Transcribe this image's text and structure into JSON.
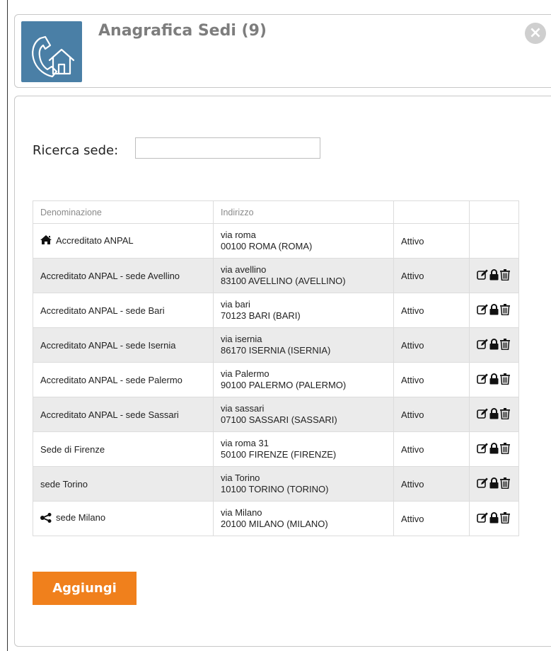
{
  "dialog": {
    "title": "Anagrafica Sedi (9)",
    "close_label": "×"
  },
  "search": {
    "label": "Ricerca sede:",
    "value": "",
    "placeholder": ""
  },
  "table": {
    "headers": [
      "Denominazione",
      "Indirizzo",
      "",
      ""
    ],
    "rows": [
      {
        "name": "Accreditato ANPAL",
        "street": "via roma",
        "city": "00100 ROMA (ROMA)",
        "status": "Attivo",
        "icon": "home-icon",
        "actions": false
      },
      {
        "name": "Accreditato ANPAL - sede Avellino",
        "street": "via avellino",
        "city": "83100 AVELLINO (AVELLINO)",
        "status": "Attivo",
        "icon": "",
        "actions": true
      },
      {
        "name": "Accreditato ANPAL - sede Bari",
        "street": "via bari",
        "city": "70123 BARI (BARI)",
        "status": "Attivo",
        "icon": "",
        "actions": true
      },
      {
        "name": "Accreditato ANPAL - sede Isernia",
        "street": "via isernia",
        "city": "86170 ISERNIA (ISERNIA)",
        "status": "Attivo",
        "icon": "",
        "actions": true
      },
      {
        "name": "Accreditato ANPAL - sede Palermo",
        "street": "via Palermo",
        "city": "90100 PALERMO (PALERMO)",
        "status": "Attivo",
        "icon": "",
        "actions": true
      },
      {
        "name": "Accreditato ANPAL - sede Sassari",
        "street": "via sassari",
        "city": "07100 SASSARI (SASSARI)",
        "status": "Attivo",
        "icon": "",
        "actions": true
      },
      {
        "name": "Sede di Firenze",
        "street": "via roma 31",
        "city": "50100 FIRENZE (FIRENZE)",
        "status": "Attivo",
        "icon": "",
        "actions": true
      },
      {
        "name": "sede Torino",
        "street": "via Torino",
        "city": "10100 TORINO (TORINO)",
        "status": "Attivo",
        "icon": "",
        "actions": true
      },
      {
        "name": "sede Milano",
        "street": "via Milano",
        "city": "20100 MILANO (MILANO)",
        "status": "Attivo",
        "icon": "share-icon",
        "actions": true
      }
    ]
  },
  "buttons": {
    "add_label": "Aggiungi"
  },
  "colors": {
    "logo_bg": "#4a7fa6",
    "add_button": "#f0801c",
    "title": "#7d7d7d"
  }
}
